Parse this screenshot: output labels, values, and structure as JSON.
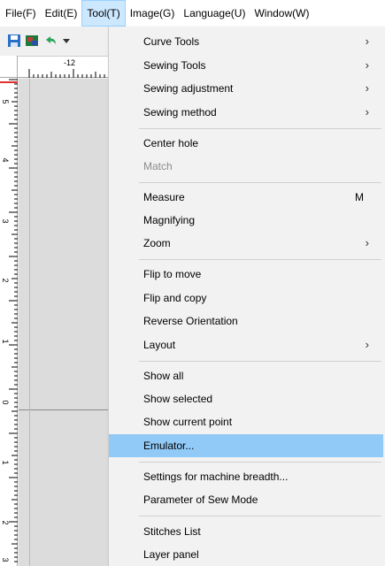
{
  "menubar": {
    "items": [
      {
        "label": "File(F)"
      },
      {
        "label": "Edit(E)"
      },
      {
        "label": "Tool(T)",
        "active": true
      },
      {
        "label": "Image(G)"
      },
      {
        "label": "Language(U)"
      },
      {
        "label": "Window(W)"
      }
    ]
  },
  "toolbar": {
    "icons": [
      "save-icon",
      "image-icon",
      "undo-icon",
      "dropdown-arrow-icon"
    ]
  },
  "ruler": {
    "horizontal_label": "-12",
    "vertical_labels": [
      "5",
      "4",
      "3",
      "2",
      "1",
      "0",
      "1",
      "2",
      "3"
    ]
  },
  "tool_menu": {
    "curve_tools": "Curve Tools",
    "sewing_tools": "Sewing Tools",
    "sewing_adjustment": "Sewing adjustment",
    "sewing_method": "Sewing method",
    "center_hole": "Center hole",
    "match": "Match",
    "measure": "Measure",
    "measure_shortcut": "M",
    "magnifying": "Magnifying",
    "zoom": "Zoom",
    "flip_to_move": "Flip to move",
    "flip_and_copy": "Flip and copy",
    "reverse_orientation": "Reverse Orientation",
    "layout": "Layout",
    "show_all": "Show all",
    "show_selected": "Show selected",
    "show_current_point": "Show current point",
    "emulator": "Emulator...",
    "settings_machine_breadth": "Settings for machine breadth...",
    "parameter_sew_mode": "Parameter of Sew Mode",
    "stitches_list": "Stitches List",
    "layer_panel": "Layer panel",
    "submenu_arrow": "›"
  },
  "colors": {
    "highlight": "#91c9f7",
    "menubar_active": "#cce8ff",
    "disabled_text": "#8c8c8c"
  }
}
